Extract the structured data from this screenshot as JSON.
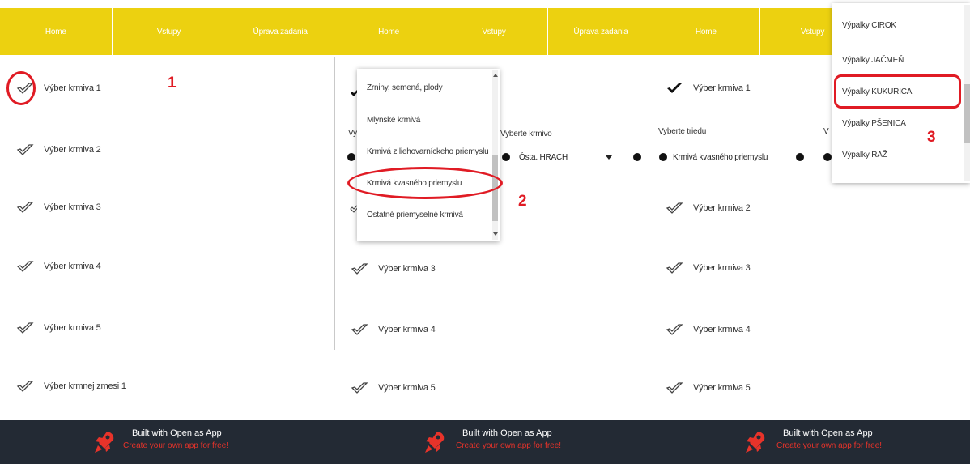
{
  "nav": {
    "home": "Home",
    "inputs": "Vstupy",
    "edit": "Úprava zadania"
  },
  "panel1": {
    "rows": [
      "Výber krmiva 1",
      "Výber krmiva 2",
      "Výber krmiva 3",
      "Výber krmiva 4",
      "Výber krmiva 5",
      "Výber krmnej zmesi 1"
    ],
    "marker": "1"
  },
  "panel2": {
    "dropdown_items": [
      "Zrniny, semená, plody",
      "Mlynské krmivá",
      "Krmivá z liehovarníckeho priemyslu",
      "Krmivá kvasného priemyslu",
      "Ostatné priemyselné krmivá"
    ],
    "select_label_left": "Vy",
    "select_label_right": "Vyberte krmivo",
    "feed_value": "Ósta. HRACH",
    "rows": [
      "Výber krmiva 3",
      "Výber krmiva 4",
      "Výber krmiva 5"
    ],
    "marker": "2"
  },
  "panel3": {
    "row1": "Výber krmiva 1",
    "class_label": "Vyberte triedu",
    "class_label2": "V",
    "class_value": "Krmivá kvasného priemyslu",
    "rows": [
      "Výber krmiva 2",
      "Výber krmiva 3",
      "Výber krmiva 4",
      "Výber krmiva 5"
    ],
    "dropdown_items": [
      "Výpalky CIROK",
      "Výpalky JAČMEŇ",
      "Výpalky KUKURICA",
      "Výpalky PŠENICA",
      "Výpalky RAŽ"
    ],
    "marker": "3"
  },
  "footer": {
    "line1": "Built with Open as App",
    "line2": "Create your own app for free!"
  },
  "colors": {
    "topbar": "#ecd110",
    "footer": "#232a34",
    "accent_red": "#e01b24"
  }
}
